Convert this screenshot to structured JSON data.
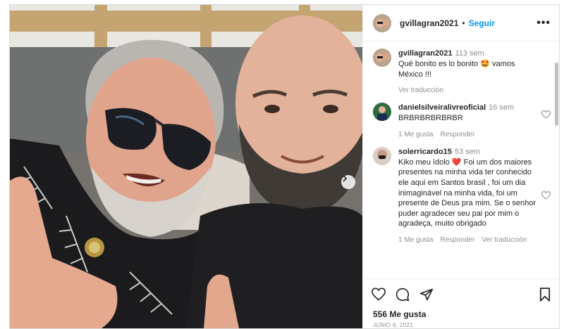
{
  "post": {
    "author": "gvillagran2021",
    "separator": "•",
    "follow_label": "Seguir",
    "more_label": "•••",
    "likes": "556 Me gusta",
    "date": "JUNIO 6, 2021"
  },
  "caption": {
    "username": "gvillagran2021",
    "time": "113 sem",
    "text_part1": "Qué bonito es lo bonito",
    "emoji": "🤩",
    "text_part2": "vamos México !!!",
    "see_translation": "Ver traducción"
  },
  "comments": [
    {
      "username": "danielsilveiralivreoficial",
      "time": "16 sem",
      "text": "BRBRBRBRBRBR",
      "like_label": "1 Me gusta",
      "reply_label": "Responder"
    },
    {
      "username": "solerricardo15",
      "time": "53 sem",
      "text_part1": "Kiko meu ídolo",
      "emoji": "❤️",
      "text_part2": "Foi um dos maiores presentes na minha vida ter conhecido ele aqui em Santos brasil , foi um dia inimaginável na minha vida, foi um presente de Deus pra mim. Se o senhor puder agradecer seu pai por mim o agradeça, muito obrigado",
      "like_label": "1 Me gusta",
      "reply_label": "Responder",
      "translation_label": "Ver traducción"
    }
  ],
  "colors": {
    "link_blue": "#0095f6",
    "text": "#262626",
    "muted": "#8e8e8e",
    "heart_red": "#ed4956"
  },
  "icons": [
    "chevron-right-icon",
    "heart-icon",
    "comment-icon",
    "share-icon",
    "bookmark-icon",
    "more-icon"
  ]
}
